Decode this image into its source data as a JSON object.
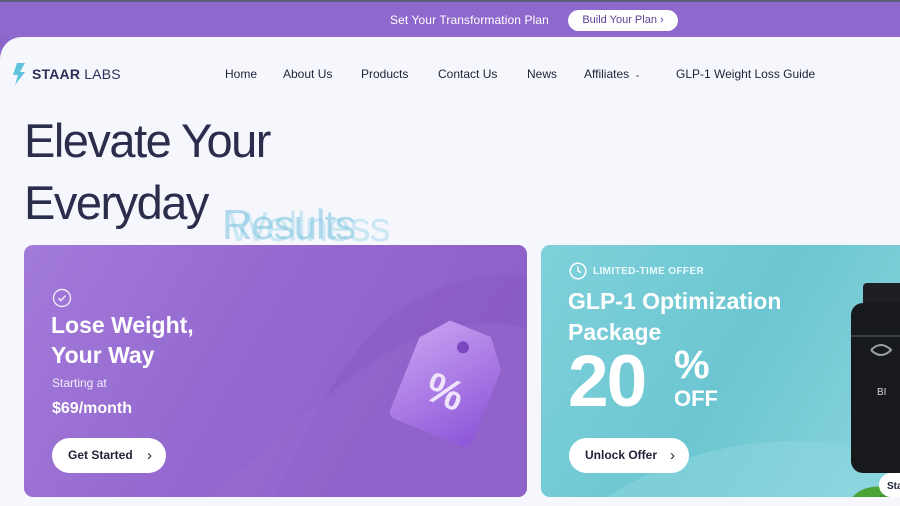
{
  "promo_bar": {
    "text": "Set Your Transformation Plan",
    "button_label": "Build Your Plan ›"
  },
  "brand": {
    "name_bold": "STAAR",
    "name_light": "LABS",
    "accent_color": "#5fc3dc"
  },
  "nav": {
    "items": [
      {
        "label": "Home"
      },
      {
        "label": "About Us"
      },
      {
        "label": "Products"
      },
      {
        "label": "Contact Us"
      },
      {
        "label": "News"
      },
      {
        "label": "Affiliates"
      },
      {
        "label": "GLP-1 Weight Loss Guide"
      }
    ],
    "affiliates_caret": "⌄"
  },
  "hero": {
    "line1": "Elevate Your",
    "line2": "Everyday",
    "rotating_word_a": "Results",
    "rotating_word_b": "Wellness"
  },
  "card_weight": {
    "title_line1": "Lose Weight,",
    "title_line2": "Your Way",
    "subtitle": "Starting at",
    "price": "$69/month",
    "button_label": "Get Started",
    "tag_symbol": "%"
  },
  "card_offer": {
    "badge": "LIMITED-TIME OFFER",
    "title_line1": "GLP-1 Optimization",
    "title_line2": "Package",
    "discount_number": "20",
    "discount_symbol": "%",
    "discount_word": "OFF",
    "button_label": "Unlock Offer",
    "bottle_label": "BI",
    "bottle_partial_button": "Sta"
  },
  "colors": {
    "promo_bg": "#8f68cd",
    "page_bg": "#f6f7fc",
    "heading": "#2a2d4c",
    "card_purple": "#9468cf",
    "card_teal": "#6cc6d1"
  }
}
